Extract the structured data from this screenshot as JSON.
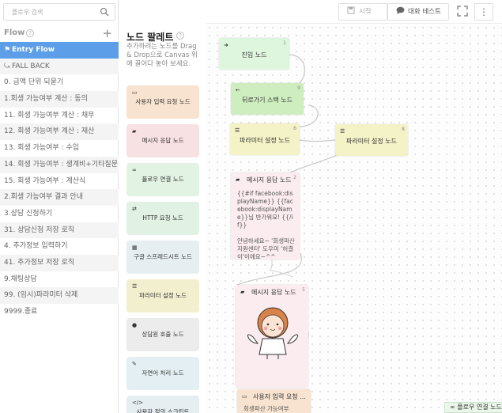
{
  "search": {
    "placeholder": "플로우 검색"
  },
  "flow": {
    "title": "Flow",
    "help": "?",
    "add": "+",
    "items": [
      {
        "label": "Entry Flow",
        "prefix": "⚑"
      },
      {
        "label": "FALL BACK",
        "prefix": "⤿"
      },
      {
        "label": "0. 금액 단위 되묻기",
        "prefix": ""
      },
      {
        "label": "1.회생 가능여부 계산 : 동의",
        "prefix": ""
      },
      {
        "label": "11. 회생 가능여부 계산 : 채무",
        "prefix": ""
      },
      {
        "label": "12. 회생 가능여부 계산 : 재산",
        "prefix": ""
      },
      {
        "label": "13. 회생 가능여부 : 수입",
        "prefix": ""
      },
      {
        "label": "14. 회생 가능여부 : 생계비+기타질문",
        "prefix": ""
      },
      {
        "label": "15. 회생 가능여부 : 계산식",
        "prefix": ""
      },
      {
        "label": "2.회생 가능여부 결과 안내",
        "prefix": ""
      },
      {
        "label": "3.상담 신청하기",
        "prefix": ""
      },
      {
        "label": "31. 상담신청 저장 로직",
        "prefix": ""
      },
      {
        "label": "4. 추가정보 입력하기",
        "prefix": ""
      },
      {
        "label": "41. 추가정보 저장 로직",
        "prefix": ""
      },
      {
        "label": "9.채팅상담",
        "prefix": ""
      },
      {
        "label": "99. (임시)파라미터 삭제",
        "prefix": ""
      },
      {
        "label": "9999.종료",
        "prefix": ""
      }
    ]
  },
  "palette": {
    "title": "노드 팔레트",
    "help": "?",
    "description": "추가하려는 노드를 Drag & Drop으로 Canvas 위에 끌어다 놓아 보세요.",
    "cards": [
      {
        "label": "사용자 입력 요청 노드",
        "icon": "▭",
        "color": "#f7e3cf"
      },
      {
        "label": "메시지 응답 노드",
        "icon": "▰",
        "color": "#f8e1e3"
      },
      {
        "label": "플로우 연결 노드",
        "icon": "∞",
        "color": "#e3f3e3"
      },
      {
        "label": "HTTP 요청 노드",
        "icon": "⇄",
        "color": "#e1f1e4"
      },
      {
        "label": "구글 스프레드시트 노드",
        "icon": "▦",
        "color": "#e6eef2"
      },
      {
        "label": "파라미터 설정 노드",
        "icon": "☰",
        "color": "#f2efcf"
      },
      {
        "label": "상담원 호출 노드",
        "icon": "●",
        "color": "#ececec"
      },
      {
        "label": "자연어 처리 노드",
        "icon": "✎",
        "color": "#e4eff3"
      },
      {
        "label": "사용자 정의 스크립트",
        "icon": "</>",
        "color": "#e6eef2"
      }
    ]
  },
  "toolbar": {
    "start_label": "시작",
    "chat_label": "대화 테스트",
    "more_label": "⋮"
  },
  "canvas": {
    "nodes": [
      {
        "id": "entry",
        "title": "진입 노드",
        "number": "1",
        "icon": "➜",
        "color": "#def6de"
      },
      {
        "id": "back",
        "title": "뒤로가기 스택 노드",
        "number": "9",
        "icon": "←",
        "color": "#cfeec0"
      },
      {
        "id": "param1",
        "title": "파라미터 설정 노드",
        "number": "6",
        "icon": "☰",
        "color": "#f4f2c7"
      },
      {
        "id": "param2",
        "title": "파라미터 설정 노드",
        "number": "8",
        "icon": "☰",
        "color": "#f4f2c7"
      },
      {
        "id": "msg1",
        "title": "메시지 응답 노드",
        "number": "2",
        "icon": "▰",
        "color": "#fbecef",
        "body": "{{#if facebook:displayName}} {{facebook:displayName}}님 반가워요! {{/if}}\n\n안녕하세요~ '회생파산 지원센터' 도우미 '허결이'이에요~^^"
      },
      {
        "id": "msg2",
        "title": "메시지 응답 노드",
        "number": "5",
        "icon": "▰",
        "color": "#fbecef"
      },
      {
        "id": "input",
        "title": "사용자 입력 요청 ...",
        "number": "",
        "icon": "▭",
        "color": "#f7e3cf",
        "body": "회생파산 가능여부"
      }
    ],
    "link_badge": "플로우 연결 노드"
  }
}
